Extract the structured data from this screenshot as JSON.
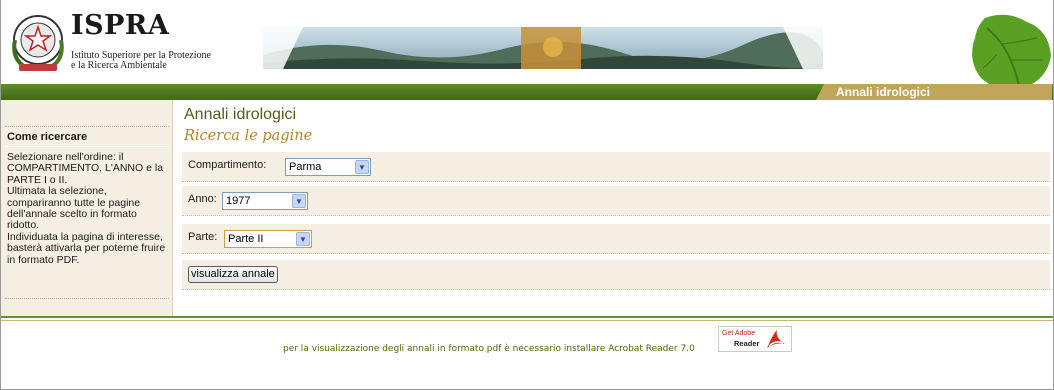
{
  "header": {
    "logo_name": "ISPRA",
    "logo_line1": "Istituto Superiore per la Protezione",
    "logo_line2": "e la Ricerca Ambientale",
    "section_tab": "Annali idrologici"
  },
  "sidebar": {
    "title": "Come ricercare",
    "text": "Selezionare nell'ordine: il COMPARTIMENTO, L'ANNO e la PARTE I o II.\nUltimata la selezione, compariranno tutte le pagine dell'annale scelto in formato ridotto.\nIndividuata la pagina di interesse, basterà attivarla per poterne fruire in formato PDF."
  },
  "main": {
    "title": "Annali idrologici",
    "subtitle": "Ricerca le pagine",
    "compartimento": {
      "label": "Compartimento:",
      "value": "Parma"
    },
    "anno": {
      "label": "Anno:",
      "value": "1977"
    },
    "parte": {
      "label": "Parte:",
      "value": "Parte II"
    },
    "submit_label": "visualizza annale"
  },
  "footer": {
    "text": "per la visualizzazione degli annali in formato pdf è necessario installare Acrobat Reader 7.0",
    "reader_badge_line1": "Get Adobe",
    "reader_badge_line2": "Reader"
  },
  "colors": {
    "green": "#4f7a1e",
    "tan": "#c0a55a",
    "panel": "#f4efe2",
    "subtitle": "#b8862a"
  }
}
